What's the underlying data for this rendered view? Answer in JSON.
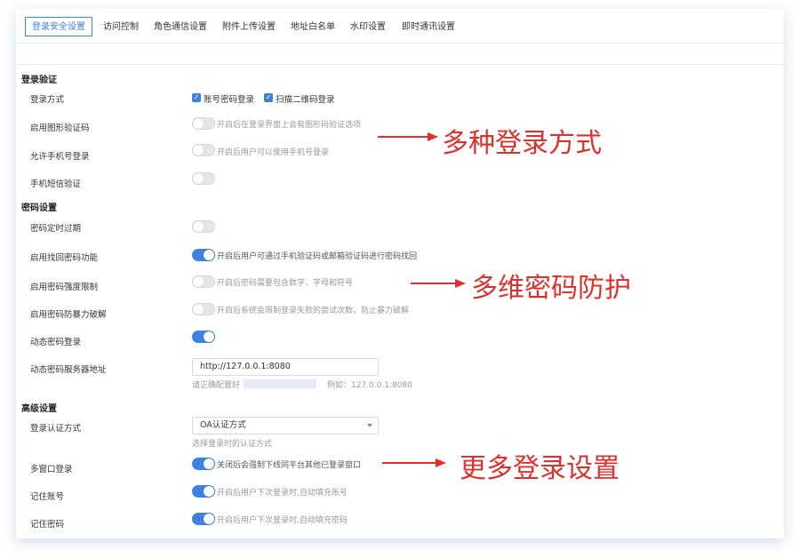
{
  "tabs": [
    {
      "label": "登录安全设置",
      "active": true
    },
    {
      "label": "访问控制"
    },
    {
      "label": "角色通信设置"
    },
    {
      "label": "附件上传设置"
    },
    {
      "label": "地址白名单"
    },
    {
      "label": "水印设置"
    },
    {
      "label": "即时通讯设置"
    }
  ],
  "sections": {
    "login": "登录验证",
    "password": "密码设置",
    "advanced": "高级设置"
  },
  "login": {
    "method_label": "登录方式",
    "method_options": [
      "账号密码登录",
      "扫描二维码登录"
    ],
    "captcha_label": "启用图形验证码",
    "captcha_desc": "开启后在登录界面上会有图形码验证选项",
    "phone_login_label": "允许手机号登录",
    "phone_login_desc": "开启后用户可以使用手机号登录",
    "sms_label": "手机短信验证"
  },
  "password": {
    "expire_label": "密码定时过期",
    "recover_label": "启用找回密码功能",
    "recover_desc": "开启后用户可通过手机验证码或邮箱验证码进行密码找回",
    "strength_label": "启用密码强度限制",
    "strength_desc": "开启后密码需要包含数字、字母和符号",
    "brute_label": "启用密码防暴力破解",
    "brute_desc": "开启后系统会限制登录失败的尝试次数，防止暴力破解",
    "dynamic_label": "动态密码登录",
    "server_label": "动态密码服务器地址",
    "server_value": "http://127.0.0.1:8080",
    "server_hint_prefix": "请正确配置好",
    "server_hint_suffix": "例如：127.0.0.1:8080"
  },
  "advanced": {
    "auth_label": "登录认证方式",
    "auth_value": "OA认证方式",
    "auth_hint": "选择登录时的认证方式",
    "multi_label": "多窗口登录",
    "multi_desc": "关闭后会强制下线同平台其他已登录窗口",
    "remember_user_label": "记住账号",
    "remember_user_desc": "开启后用户下次登录时,自动填充账号",
    "remember_pwd_label": "记住密码",
    "remember_pwd_desc": "开启后用户下次登录时,自动填充密码"
  },
  "annotations": {
    "a1": "多种登录方式",
    "a2": "多维密码防护",
    "a3": "更多登录设置"
  },
  "colors": {
    "accent": "#3d82e0",
    "annotation": "#e0302c"
  }
}
